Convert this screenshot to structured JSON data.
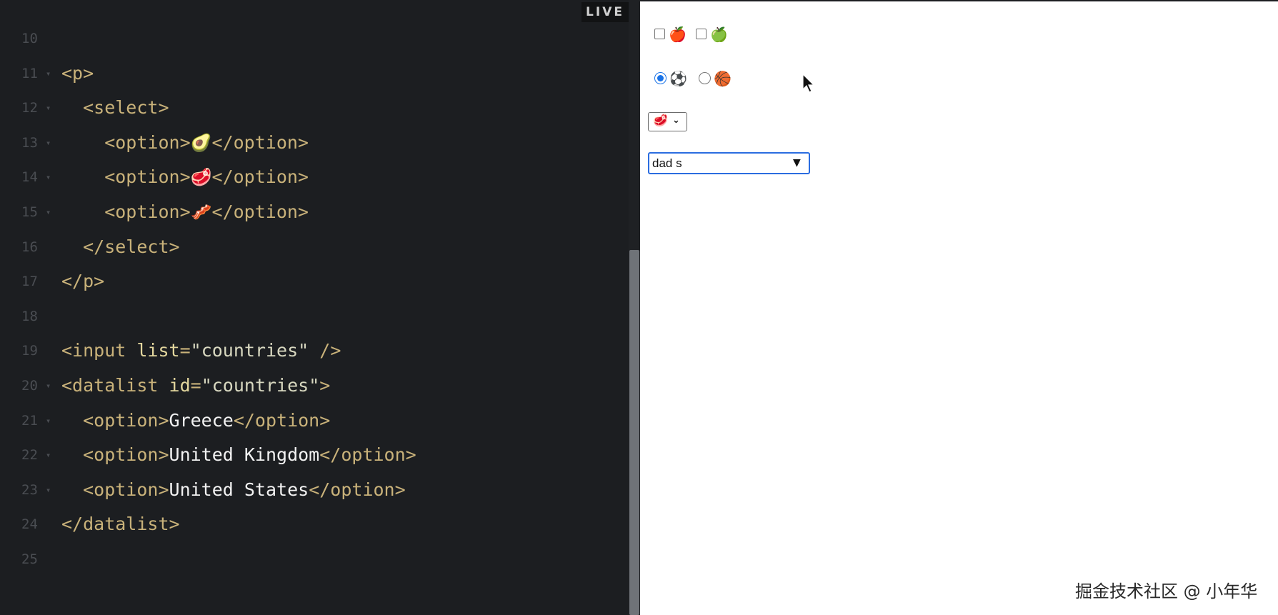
{
  "editor": {
    "live_label": "LIVE",
    "lines": [
      {
        "num": "10",
        "fold": "",
        "parts": []
      },
      {
        "num": "11",
        "fold": "▾",
        "parts": [
          {
            "t": "tag",
            "v": "<p>"
          }
        ]
      },
      {
        "num": "12",
        "fold": "▾",
        "parts": [
          {
            "t": "tag",
            "v": "  <select>"
          }
        ]
      },
      {
        "num": "13",
        "fold": "▾",
        "parts": [
          {
            "t": "tag",
            "v": "    <option>"
          },
          {
            "t": "emo",
            "v": "🥑"
          },
          {
            "t": "tag",
            "v": "</option>"
          }
        ]
      },
      {
        "num": "14",
        "fold": "▾",
        "parts": [
          {
            "t": "tag",
            "v": "    <option>"
          },
          {
            "t": "emo",
            "v": "🥩"
          },
          {
            "t": "tag",
            "v": "</option>"
          }
        ]
      },
      {
        "num": "15",
        "fold": "▾",
        "parts": [
          {
            "t": "tag",
            "v": "    <option>"
          },
          {
            "t": "emo",
            "v": "🥓"
          },
          {
            "t": "tag",
            "v": "</option>"
          }
        ]
      },
      {
        "num": "16",
        "fold": "",
        "parts": [
          {
            "t": "tag",
            "v": "  </select>"
          }
        ]
      },
      {
        "num": "17",
        "fold": "",
        "parts": [
          {
            "t": "tag",
            "v": "</p>"
          }
        ]
      },
      {
        "num": "18",
        "fold": "",
        "parts": []
      },
      {
        "num": "19",
        "fold": "",
        "parts": [
          {
            "t": "tag",
            "v": "<input "
          },
          {
            "t": "attr",
            "v": "list"
          },
          {
            "t": "tag",
            "v": "="
          },
          {
            "t": "str",
            "v": "\"countries\""
          },
          {
            "t": "tag",
            "v": " />"
          }
        ]
      },
      {
        "num": "20",
        "fold": "▾",
        "parts": [
          {
            "t": "tag",
            "v": "<datalist "
          },
          {
            "t": "attr",
            "v": "id"
          },
          {
            "t": "tag",
            "v": "="
          },
          {
            "t": "str",
            "v": "\"countries\""
          },
          {
            "t": "tag",
            "v": ">"
          }
        ]
      },
      {
        "num": "21",
        "fold": "▾",
        "parts": [
          {
            "t": "tag",
            "v": "  <option>"
          },
          {
            "t": "txt",
            "v": "Greece"
          },
          {
            "t": "tag",
            "v": "</option>"
          }
        ]
      },
      {
        "num": "22",
        "fold": "▾",
        "parts": [
          {
            "t": "tag",
            "v": "  <option>"
          },
          {
            "t": "txt",
            "v": "United Kingdom"
          },
          {
            "t": "tag",
            "v": "</option>"
          }
        ]
      },
      {
        "num": "23",
        "fold": "▾",
        "parts": [
          {
            "t": "tag",
            "v": "  <option>"
          },
          {
            "t": "txt",
            "v": "United States"
          },
          {
            "t": "tag",
            "v": "</option>"
          }
        ]
      },
      {
        "num": "24",
        "fold": "",
        "parts": [
          {
            "t": "tag",
            "v": "</datalist>"
          }
        ]
      },
      {
        "num": "25",
        "fold": "",
        "parts": []
      }
    ]
  },
  "preview": {
    "checkboxes": [
      {
        "emoji": "🍎",
        "checked": false
      },
      {
        "emoji": "🍏",
        "checked": false
      }
    ],
    "radios": [
      {
        "emoji": "⚽",
        "checked": true
      },
      {
        "emoji": "🏀",
        "checked": false
      }
    ],
    "food_select": {
      "selected": "🥩",
      "chevron": "⌄"
    },
    "country_input": {
      "value": "dad s",
      "arrow": "▼"
    }
  },
  "watermark": "掘金技术社区 @ 小年华",
  "colors": {
    "editor_bg": "#1c1e21",
    "tag": "#c9b27a",
    "attr": "#e3d79e",
    "text": "#f2f2f2",
    "focus_blue": "#2b6de0"
  }
}
